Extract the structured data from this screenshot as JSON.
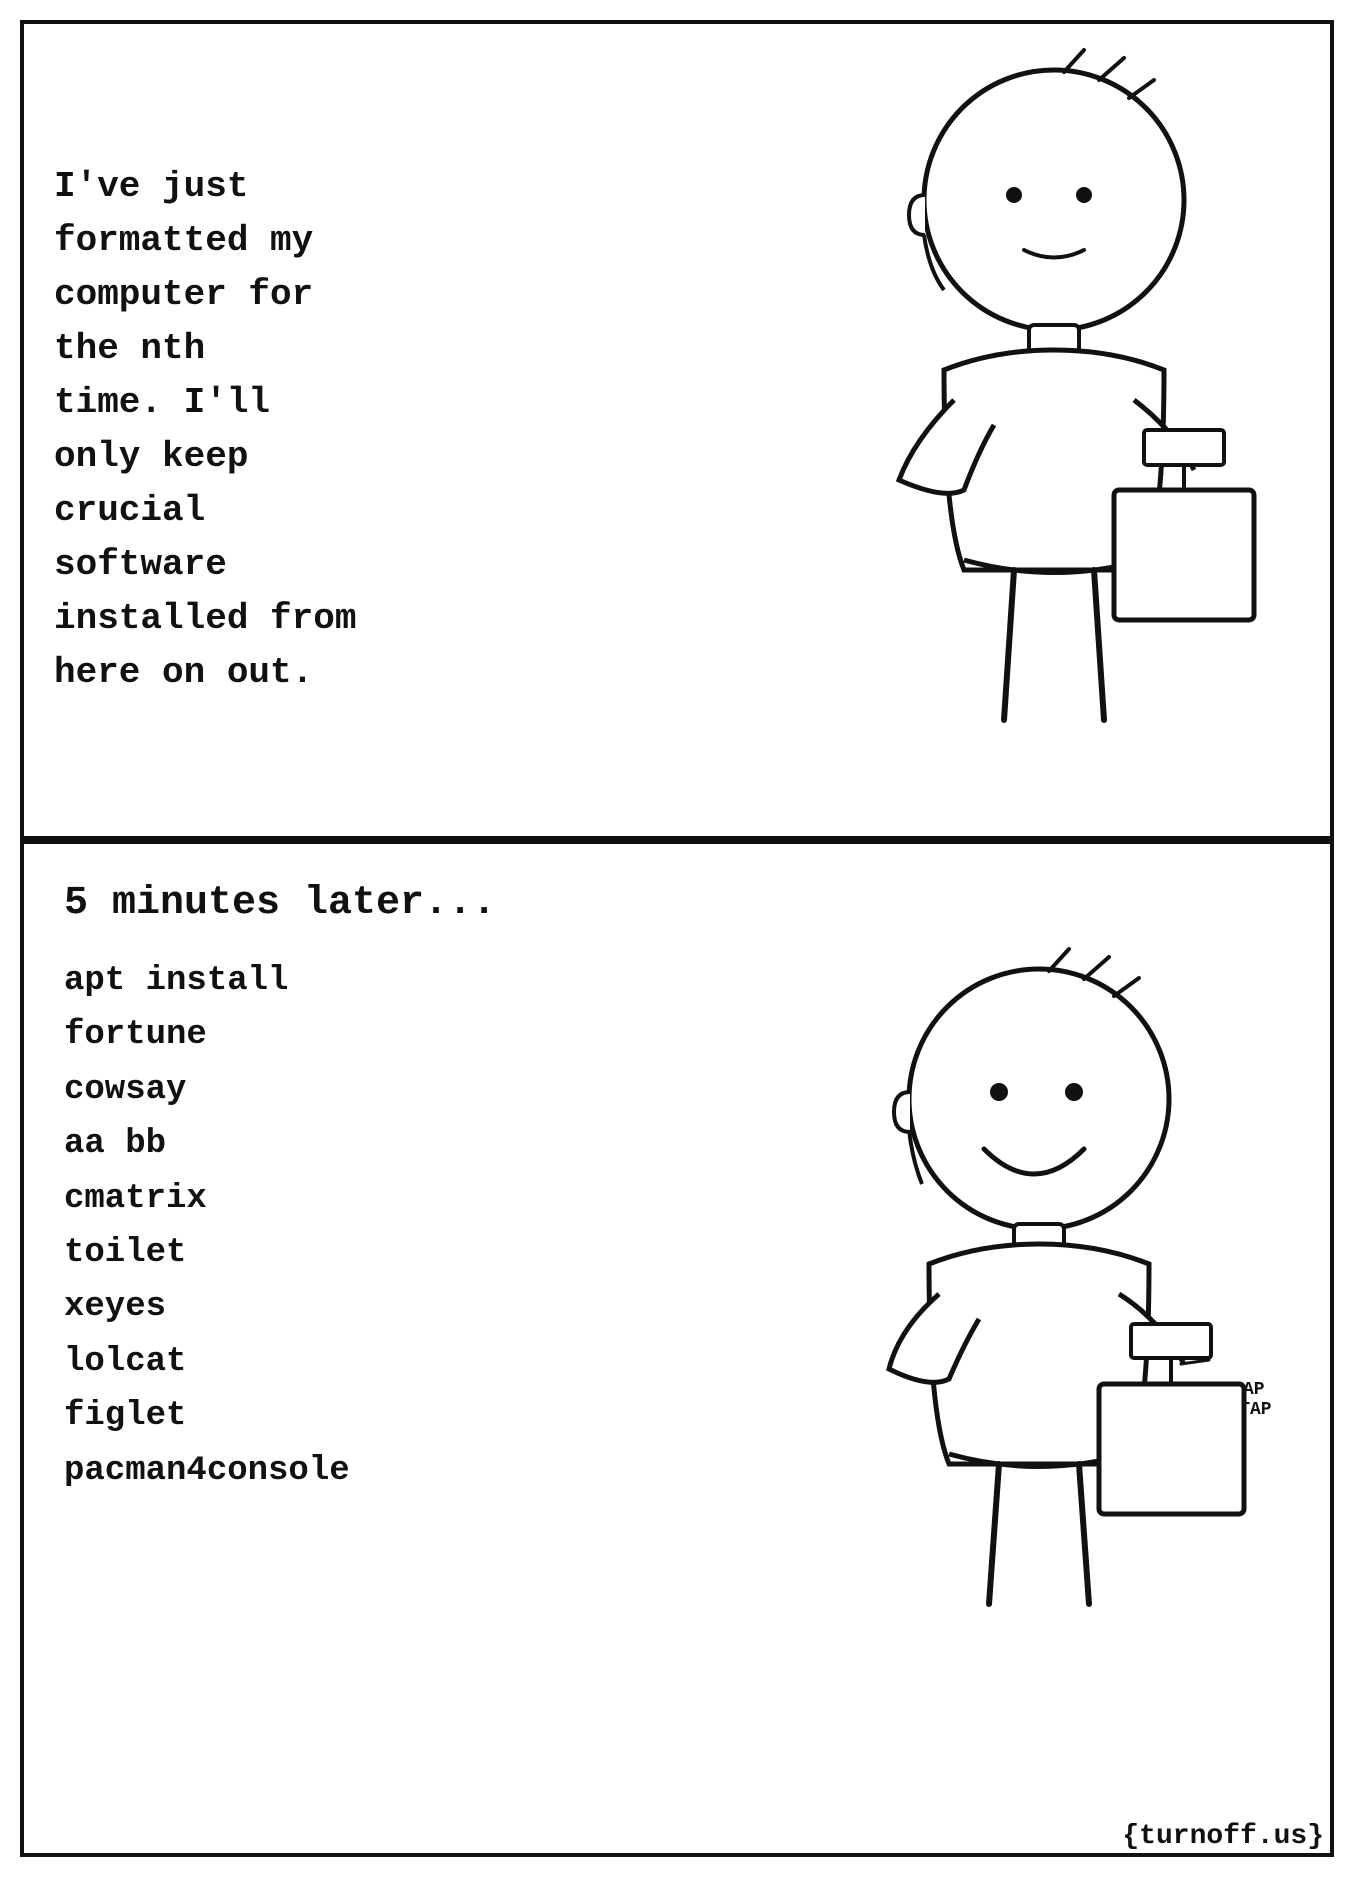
{
  "comic": {
    "panel1": {
      "text": "I've just\nformatted my\ncomputer for\nthe nth\ntime. I'll\nonly keep\ncrucial\nsoftware\ninstalled from\nhere on out."
    },
    "panel2": {
      "header": "5 minutes later...",
      "commands": "apt install\nfortune\ncowsay\naa bb\ncmatrix\ntoilet\nxeyes\nlolcat\nfiglet\npacman4console"
    },
    "watermark": "{turnoff.us}"
  }
}
